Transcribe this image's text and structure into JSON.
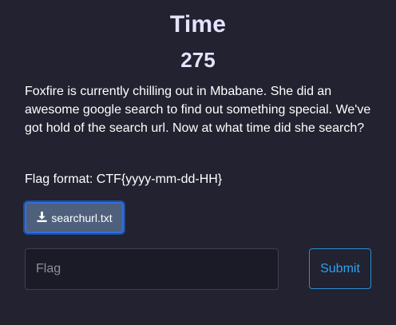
{
  "challenge": {
    "title": "Time",
    "points": "275",
    "description": "Foxfire is currently chilling out in Mbabane. She did an awesome google search to find out something special. We've got hold of the search url. Now at what time did she search?",
    "flag_format": "Flag format: CTF{yyyy-mm-dd-HH}"
  },
  "download": {
    "label": "searchurl.txt",
    "icon": "download-icon"
  },
  "form": {
    "flag_placeholder": "Flag",
    "flag_value": "",
    "submit_label": "Submit"
  },
  "colors": {
    "background": "#222231",
    "title": "#e6e2ff",
    "download_bg": "#4e607c",
    "download_border": "#2f6fe0",
    "submit_accent": "#2ba3f0"
  }
}
